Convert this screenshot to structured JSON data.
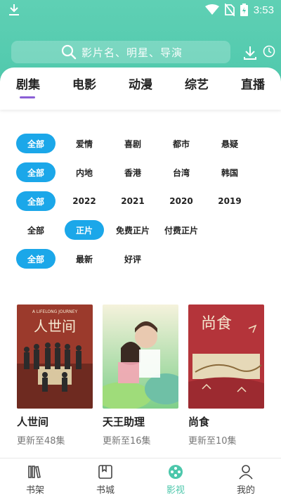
{
  "status": {
    "time": "3:53"
  },
  "search": {
    "placeholder": "影片名、明星、导演"
  },
  "tabs": [
    {
      "label": "剧集",
      "active": true
    },
    {
      "label": "电影"
    },
    {
      "label": "动漫"
    },
    {
      "label": "综艺"
    },
    {
      "label": "直播"
    }
  ],
  "filters": {
    "genre": [
      "全部",
      "爱情",
      "喜剧",
      "都市",
      "悬疑"
    ],
    "region": [
      "全部",
      "内地",
      "香港",
      "台湾",
      "韩国"
    ],
    "year": [
      "全部",
      "2022",
      "2021",
      "2020",
      "2019"
    ],
    "pay": [
      "全部",
      "正片",
      "免费正片",
      "付费正片"
    ],
    "sort": [
      "全部",
      "最新",
      "好评"
    ]
  },
  "cards": [
    {
      "title": "人世间",
      "status": "更新至48集",
      "poster_title": "人世间",
      "poster_tagline": "A LIFELONG JOURNEY"
    },
    {
      "title": "天王助理",
      "status": "更新至16集"
    },
    {
      "title": "尚食",
      "status": "更新至10集",
      "poster_title": "尚食"
    }
  ],
  "nav": [
    {
      "label": "书架",
      "icon": "bookshelf-icon"
    },
    {
      "label": "书城",
      "icon": "bookstore-icon"
    },
    {
      "label": "影视",
      "icon": "film-reel-icon",
      "active": true
    },
    {
      "label": "我的",
      "icon": "profile-icon"
    }
  ],
  "colors": {
    "header": "#4cc7ab",
    "chip_active": "#1ba7e9",
    "tab_indicator": "#8b5fd6"
  }
}
